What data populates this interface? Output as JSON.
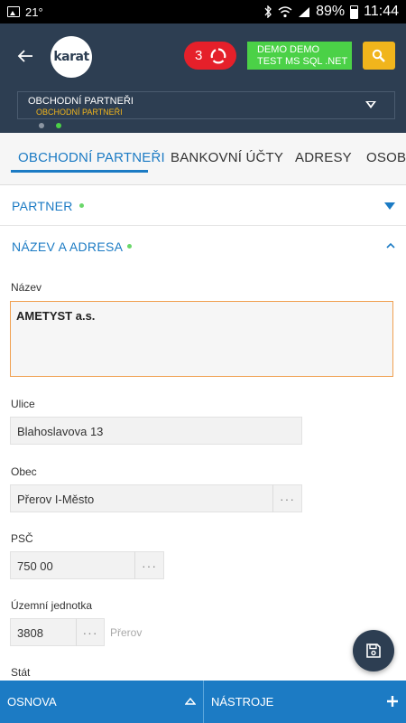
{
  "statusbar": {
    "temp": "21°",
    "battery_pct": "89%",
    "time": "11:44"
  },
  "header": {
    "notification_count": "3",
    "demo_line1": "DEMO DEMO",
    "demo_line2": "TEST MS SQL .NET",
    "logo_text": "karat",
    "selector_title": "OBCHODNÍ PARTNEŘI",
    "selector_subtitle": "OBCHODNÍ PARTNEŘI",
    "colors": {
      "header_bg": "#2d3e52",
      "notif": "#e5202a",
      "demo": "#4bd147",
      "search": "#f1b51c",
      "accent": "#1c7bc4"
    }
  },
  "tabs": [
    {
      "label": "OBCHODNÍ PARTNEŘI",
      "active": true
    },
    {
      "label": "BANKOVNÍ ÚČTY",
      "active": false
    },
    {
      "label": "ADRESY",
      "active": false
    },
    {
      "label": "OSOBY",
      "active": false
    }
  ],
  "sections": {
    "partner": {
      "label": "PARTNER",
      "state": "collapsed"
    },
    "name_address": {
      "label": "NÁZEV A ADRESA",
      "state": "expanded"
    }
  },
  "form": {
    "nazev": {
      "label": "Název",
      "value": "AMETYST a.s."
    },
    "ulice": {
      "label": "Ulice",
      "value": "Blahoslavova 13"
    },
    "obec": {
      "label": "Obec",
      "value": "Přerov I-Město"
    },
    "psc": {
      "label": "PSČ",
      "value": "750 00"
    },
    "uzemni": {
      "label": "Územní jednotka",
      "value": "3808",
      "side": "Přerov"
    },
    "stat": {
      "label": "Stát"
    }
  },
  "bottom": {
    "left_label": "OSNOVA",
    "right_label": "NÁSTROJE"
  },
  "icons": [
    "back-arrow-icon",
    "refresh-icon",
    "search-icon",
    "caret-down-icon",
    "chevron-down-icon",
    "chevron-up-icon",
    "save-icon",
    "plus-icon",
    "more-dots-icon"
  ]
}
